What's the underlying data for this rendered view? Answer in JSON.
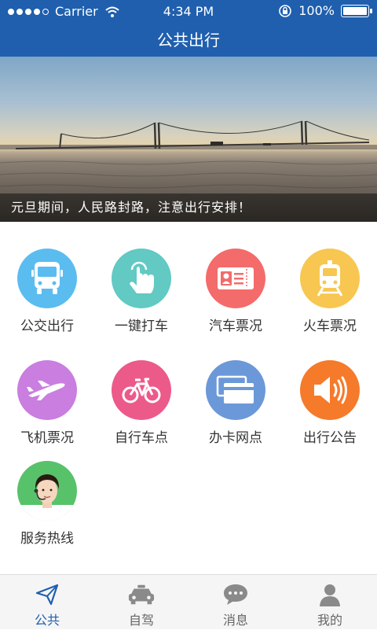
{
  "status_bar": {
    "carrier": "Carrier",
    "time": "4:34 PM",
    "battery": "100%",
    "battery_level": 1.0
  },
  "nav": {
    "title": "公共出行"
  },
  "banner": {
    "caption": "元旦期间，人民路封路，注意出行安排！"
  },
  "services": [
    {
      "label": "公交出行",
      "icon": "bus-icon",
      "color": "#5bbcf0"
    },
    {
      "label": "一键打车",
      "icon": "tap-hand-icon",
      "color": "#62c9c3"
    },
    {
      "label": "汽车票况",
      "icon": "ticket-icon",
      "color": "#f46b6b"
    },
    {
      "label": "火车票况",
      "icon": "train-icon",
      "color": "#f8c752"
    },
    {
      "label": "飞机票况",
      "icon": "airplane-icon",
      "color": "#c97ee0"
    },
    {
      "label": "自行车点",
      "icon": "bicycle-icon",
      "color": "#ec5a8a"
    },
    {
      "label": "办卡网点",
      "icon": "cards-icon",
      "color": "#6b98d8"
    },
    {
      "label": "出行公告",
      "icon": "speaker-icon",
      "color": "#f57a2a"
    },
    {
      "label": "服务热线",
      "icon": "hotline-agent-icon",
      "color": "#58c26a"
    }
  ],
  "tabs": [
    {
      "label": "公共",
      "icon": "paper-plane-icon",
      "active": true
    },
    {
      "label": "自驾",
      "icon": "car-icon",
      "active": false
    },
    {
      "label": "消息",
      "icon": "chat-bubble-icon",
      "active": false
    },
    {
      "label": "我的",
      "icon": "person-icon",
      "active": false
    }
  ],
  "colors": {
    "primary": "#1f5fae",
    "tab_active": "#1f5fae",
    "tab_inactive": "#8a8a8a"
  }
}
